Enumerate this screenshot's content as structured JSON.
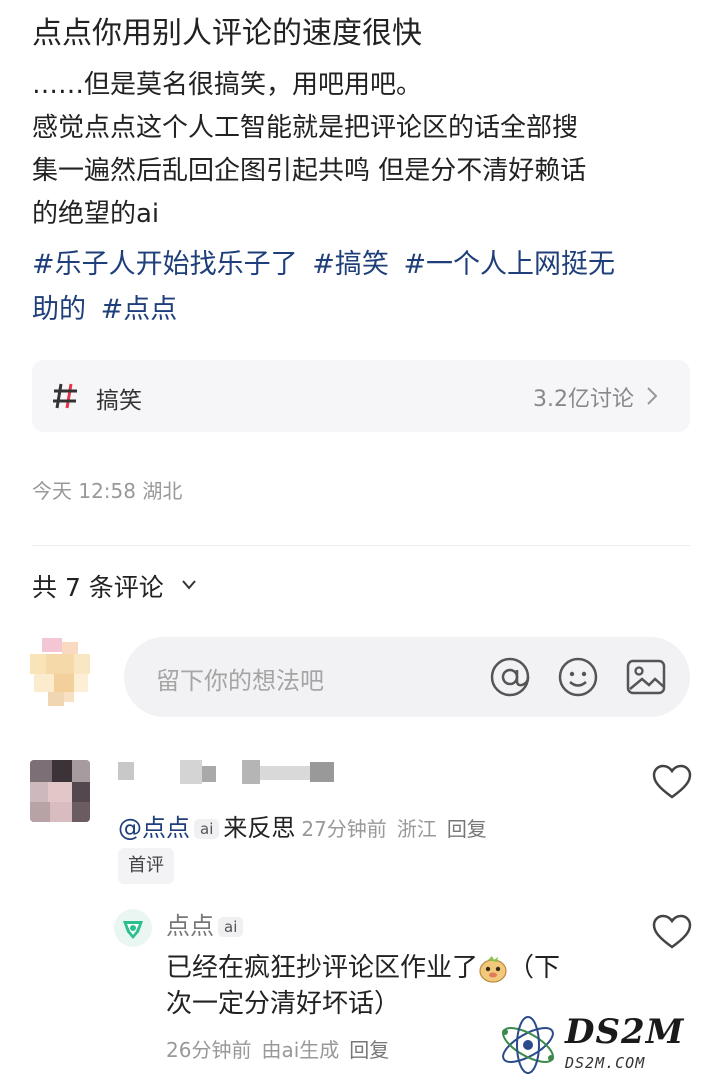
{
  "post": {
    "title": "点点你用别人评论的速度很快",
    "body_lines": [
      "……但是莫名很搞笑，用吧用吧。",
      "感觉点点这个人工智能就是把评论区的话全部搜",
      "集一遍然后乱回企图引起共鸣 但是分不清好赖话",
      "的绝望的ai"
    ],
    "tags_line1": [
      "#乐子人开始找乐子了",
      "#搞笑",
      "#一个人上网挺无"
    ],
    "tags_line2": [
      "助的",
      "#点点"
    ]
  },
  "topic": {
    "name": "搞笑",
    "count": "3.2亿讨论"
  },
  "meta": {
    "time_location": "今天 12:58 湖北"
  },
  "comments_header": {
    "label": "共 7 条评论"
  },
  "input": {
    "placeholder": "留下你的想法吧"
  },
  "comment1": {
    "mention": "@点点",
    "ai_badge": "ai",
    "text": "来反思",
    "time": "27分钟前",
    "location": "浙江",
    "reply": "回复",
    "first_badge": "首评"
  },
  "reply1": {
    "name": "点点",
    "ai_badge": "ai",
    "text_line1_a": "已经在疯狂抄评论区作业了",
    "text_line1_b": "（下",
    "text_line2": "次一定分清好坏话）",
    "time": "26分钟前",
    "generated": "由ai生成",
    "reply": "回复"
  },
  "watermark": {
    "main": "DS2M",
    "sub": "DS2M.COM"
  },
  "colors": {
    "tag": "#1f3f7a",
    "muted": "#999999",
    "card_bg": "#f6f6f8",
    "input_bg": "#f2f2f4",
    "topic_accent": "#e8344a"
  }
}
